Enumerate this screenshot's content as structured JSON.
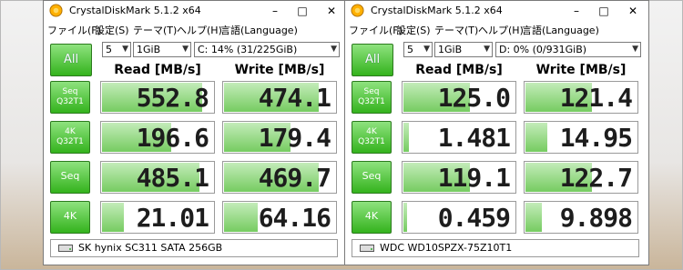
{
  "windows": [
    {
      "title": "CrystalDiskMark 5.1.2 x64",
      "menu": [
        "ファイル(F)",
        "設定(S)",
        "テーマ(T)",
        "ヘルプ(H)",
        "言語(Language)"
      ],
      "count": "5",
      "size": "1GiB",
      "drive": "C: 14% (31/225GiB)",
      "all_label": "All",
      "read_header": "Read [MB/s]",
      "write_header": "Write [MB/s]",
      "rows": [
        {
          "label1": "Seq",
          "label2": "Q32T1",
          "read": "552.8",
          "write": "474.1",
          "read_fill": 0.9,
          "write_fill": 0.85
        },
        {
          "label1": "4K",
          "label2": "Q32T1",
          "read": "196.6",
          "write": "179.4",
          "read_fill": 0.62,
          "write_fill": 0.6
        },
        {
          "label1": "Seq",
          "label2": "",
          "read": "485.1",
          "write": "469.7",
          "read_fill": 0.88,
          "write_fill": 0.85
        },
        {
          "label1": "4K",
          "label2": "",
          "read": "21.01",
          "write": "64.16",
          "read_fill": 0.2,
          "write_fill": 0.3
        }
      ],
      "footer": "SK hynix SC311 SATA 256GB"
    },
    {
      "title": "CrystalDiskMark 5.1.2 x64",
      "menu": [
        "ファイル(F)",
        "設定(S)",
        "テーマ(T)",
        "ヘルプ(H)",
        "言語(Language)"
      ],
      "count": "5",
      "size": "1GiB",
      "drive": "D: 0% (0/931GiB)",
      "all_label": "All",
      "read_header": "Read [MB/s]",
      "write_header": "Write [MB/s]",
      "rows": [
        {
          "label1": "Seq",
          "label2": "Q32T1",
          "read": "125.0",
          "write": "121.4",
          "read_fill": 0.6,
          "write_fill": 0.6
        },
        {
          "label1": "4K",
          "label2": "Q32T1",
          "read": "1.481",
          "write": "14.95",
          "read_fill": 0.05,
          "write_fill": 0.2
        },
        {
          "label1": "Seq",
          "label2": "",
          "read": "119.1",
          "write": "122.7",
          "read_fill": 0.6,
          "write_fill": 0.6
        },
        {
          "label1": "4K",
          "label2": "",
          "read": "0.459",
          "write": "9.898",
          "read_fill": 0.03,
          "write_fill": 0.15
        }
      ],
      "footer": "WDC WD10SPZX-75Z10T1"
    }
  ],
  "colors": {
    "button_green": "#34b31d",
    "bar_green": "#76cc61"
  },
  "icons": {
    "app": "crystaldiskmark-icon",
    "drive": "hard-drive-icon"
  }
}
